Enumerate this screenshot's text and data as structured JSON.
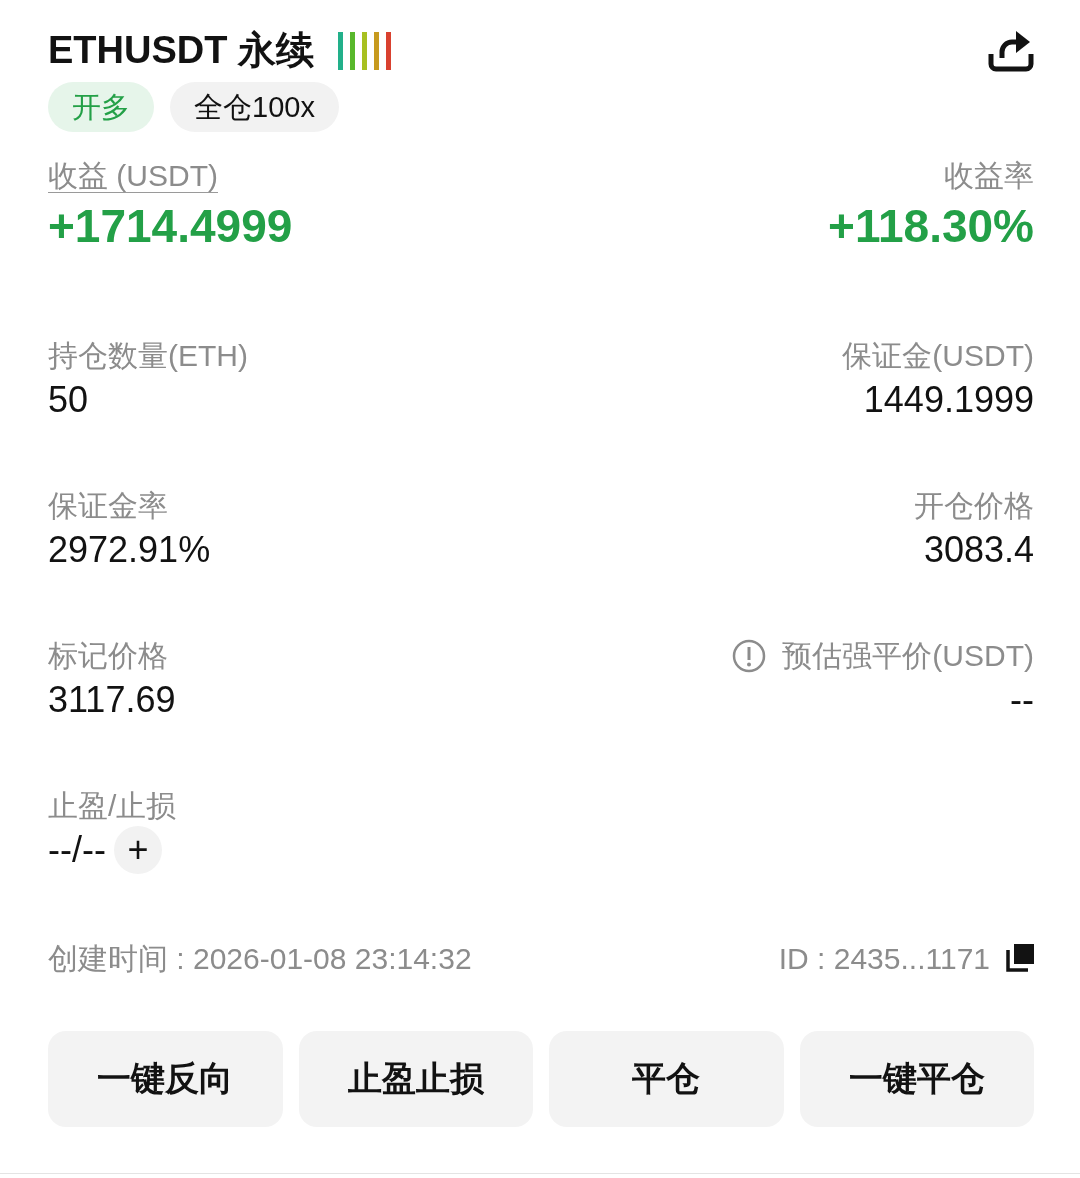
{
  "header": {
    "symbol": "ETHUSDT 永续"
  },
  "tags": [
    {
      "label": "开多",
      "kind": "side"
    },
    {
      "label": "全仓100x",
      "kind": "margin"
    }
  ],
  "pnl": {
    "label": "收益 (USDT)",
    "value": "+1714.4999"
  },
  "roe": {
    "label": "收益率",
    "value": "+118.30%"
  },
  "rows": [
    {
      "left": {
        "label": "持仓数量(ETH)",
        "value": "50"
      },
      "right": {
        "label": "保证金(USDT)",
        "value": "1449.1999",
        "info": false
      }
    },
    {
      "left": {
        "label": "保证金率",
        "value": "2972.91%"
      },
      "right": {
        "label": "开仓价格",
        "value": "3083.4",
        "info": false
      }
    },
    {
      "left": {
        "label": "标记价格",
        "value": "3117.69"
      },
      "right": {
        "label": "预估强平价(USDT)",
        "value": "--",
        "info": true
      }
    }
  ],
  "tpsl": {
    "label": "止盈/止损",
    "value": "--/--",
    "add": "+"
  },
  "footer": {
    "created": "创建时间 : 2026-01-08 23:14:32",
    "id": "ID : 2435...1171"
  },
  "buttons": [
    "一键反向",
    "止盈止损",
    "平仓",
    "一键平仓"
  ]
}
